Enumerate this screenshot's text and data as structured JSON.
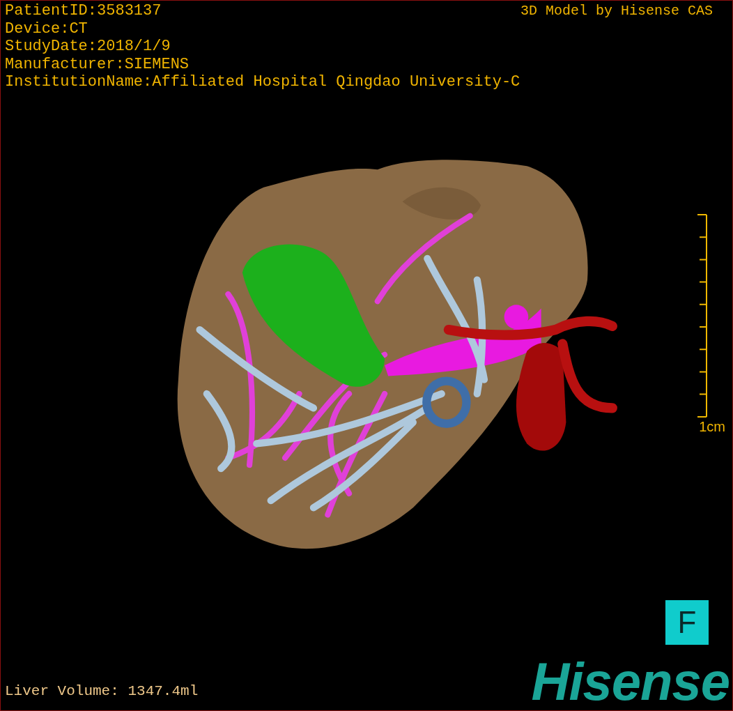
{
  "info_lines": [
    "PatientID:3583137",
    "Device:CT",
    "StudyDate:2018/1/9",
    "Manufacturer:SIEMENS",
    "InstitutionName:Affiliated Hospital Qingdao University-C"
  ],
  "credit": "3D Model by Hisense CAS",
  "scale": {
    "label": "1cm"
  },
  "orientation": "F",
  "liver_volume": "Liver Volume: 1347.4ml",
  "logo": "Hisense"
}
